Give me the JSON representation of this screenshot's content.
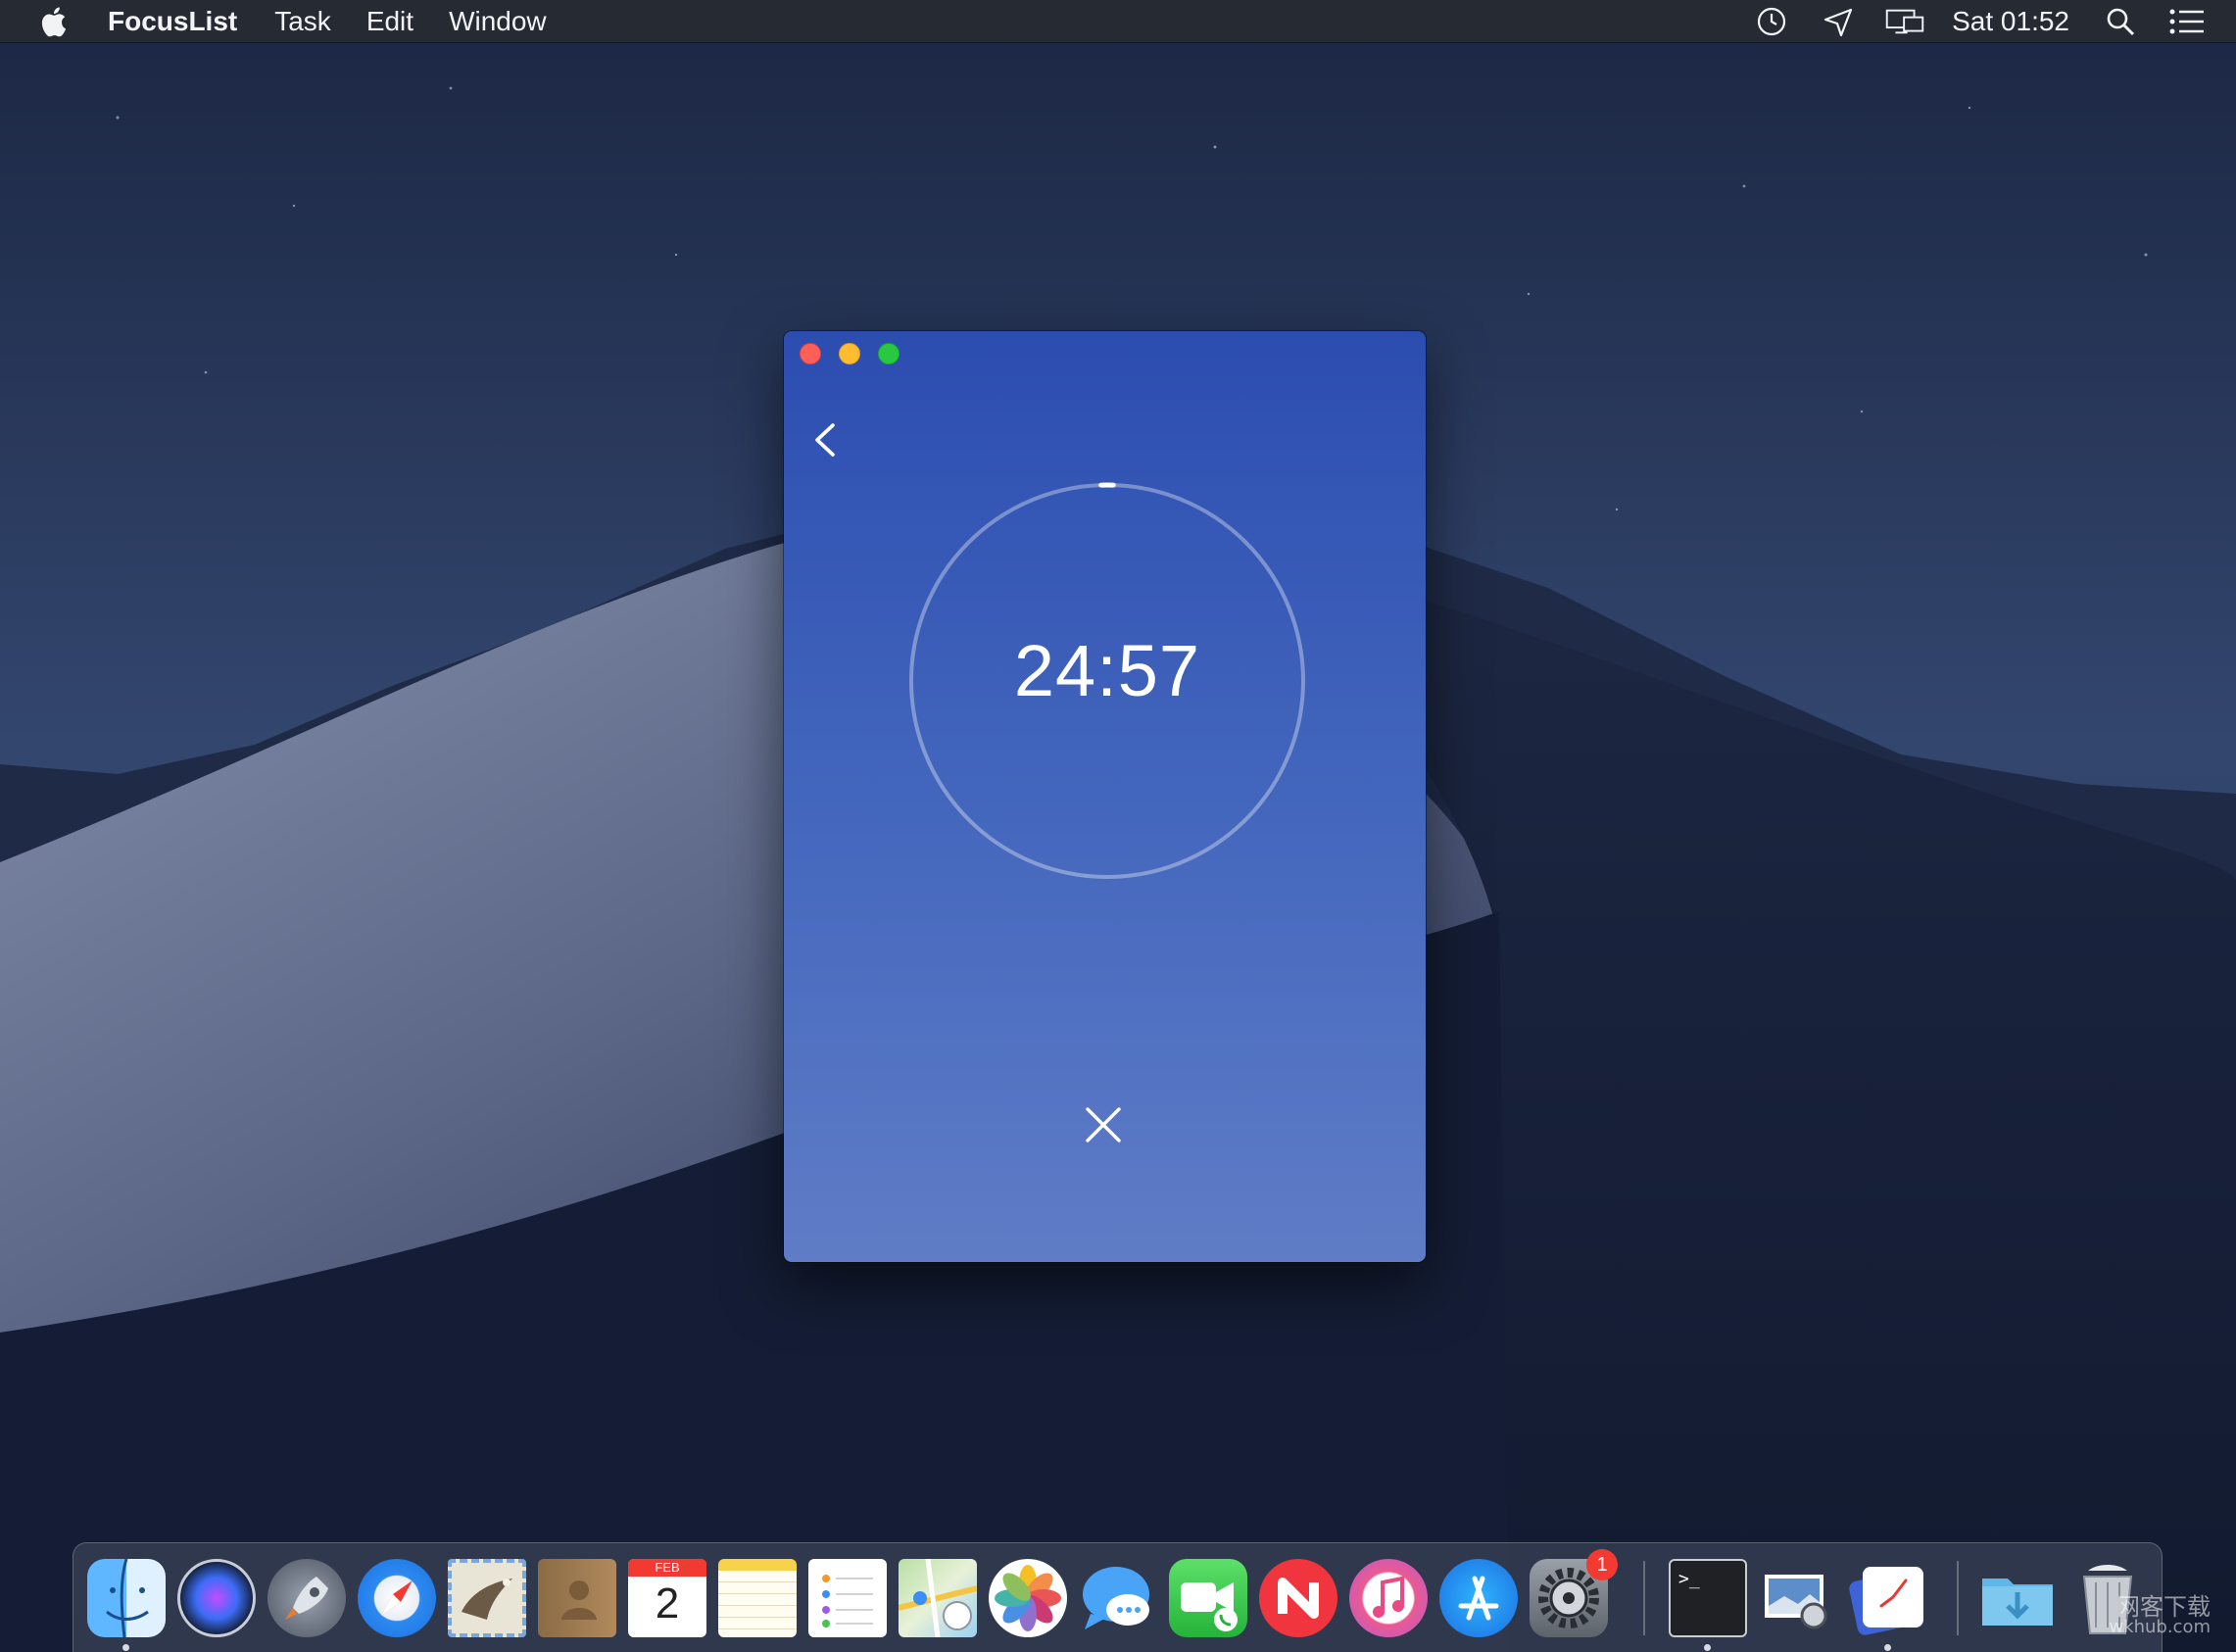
{
  "menubar": {
    "apple_icon": "apple-logo-icon",
    "app_name": "FocusList",
    "menus": [
      "Task",
      "Edit",
      "Window"
    ],
    "status_icons": [
      "time-machine-icon",
      "location-arrow-icon",
      "display-mirroring-icon",
      "spotlight-search-icon",
      "notification-center-icon"
    ],
    "clock": "Sat 01:52"
  },
  "window": {
    "background_top": "#2c4db0",
    "background_bottom": "#5f7cc6",
    "back_icon": "chevron-left-icon",
    "timer_text": "24:57",
    "timer_progress": 0.002,
    "cancel_icon": "close-x-icon"
  },
  "dock": {
    "apps": [
      {
        "name": "finder",
        "running": true
      },
      {
        "name": "siri",
        "running": false
      },
      {
        "name": "launchpad",
        "running": false
      },
      {
        "name": "safari",
        "running": false
      },
      {
        "name": "mail",
        "running": false
      },
      {
        "name": "contacts",
        "running": false
      },
      {
        "name": "calendar",
        "running": false
      },
      {
        "name": "notes",
        "running": false
      },
      {
        "name": "reminders",
        "running": false
      },
      {
        "name": "maps",
        "running": false
      },
      {
        "name": "photos",
        "running": false
      },
      {
        "name": "messages",
        "running": false
      },
      {
        "name": "facetime",
        "running": false
      },
      {
        "name": "news",
        "running": false
      },
      {
        "name": "itunes",
        "running": false
      },
      {
        "name": "app-store",
        "running": false
      },
      {
        "name": "system-preferences",
        "running": false
      },
      {
        "name": "terminal",
        "running": true
      },
      {
        "name": "preview",
        "running": false
      },
      {
        "name": "focuslist",
        "running": true
      },
      {
        "name": "downloads-folder",
        "running": false
      },
      {
        "name": "trash",
        "running": false
      }
    ],
    "calendar_month": "FEB",
    "calendar_day": "2",
    "terminal_prompt": ">_",
    "system_preferences_badge": "1"
  },
  "watermark": {
    "line1": "网客下载",
    "line2": "wkhub.com"
  }
}
